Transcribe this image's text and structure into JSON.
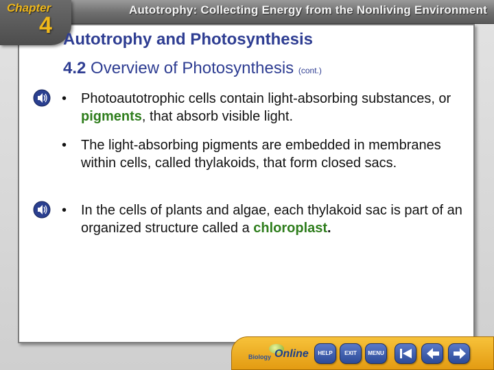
{
  "header": {
    "chapter_label": "Chapter",
    "chapter_number": "4",
    "banner_title": "Autotrophy: Collecting Energy from the Nonliving Environment"
  },
  "slide": {
    "title": "Autotrophy and Photosynthesis",
    "subtitle_number": "4.2",
    "subtitle_text": "Overview of Photosynthesis",
    "subtitle_cont": "(cont.)",
    "bullets": [
      {
        "before": "Photoautotrophic cells contain light-absorbing substances, or ",
        "highlight": "pigments",
        "after": ", that absorb visible light."
      },
      {
        "text": "The light-absorbing pigments are embedded in membranes within cells, called thylakoids, that form closed sacs."
      },
      {
        "before": "In the cells of plants and algae, each thylakoid sac is part of an organized structure called a ",
        "highlight": "chloroplast",
        "after": "."
      }
    ],
    "bullet_marker": "•"
  },
  "navbar": {
    "logo_text": "Biology",
    "logo_online": "Online",
    "help_label": "HELP",
    "exit_label": "EXIT",
    "menu_label": "MENU"
  },
  "colors": {
    "title": "#2e3d92",
    "highlight": "#2e7d1c",
    "chapter_accent": "#f0b81a",
    "navbar": "#f0ad20",
    "nav_button": "#2c4b98"
  },
  "icons": {
    "audio": "speaker-icon",
    "first": "first-slide-icon",
    "previous": "previous-arrow-icon",
    "next": "next-arrow-icon"
  }
}
